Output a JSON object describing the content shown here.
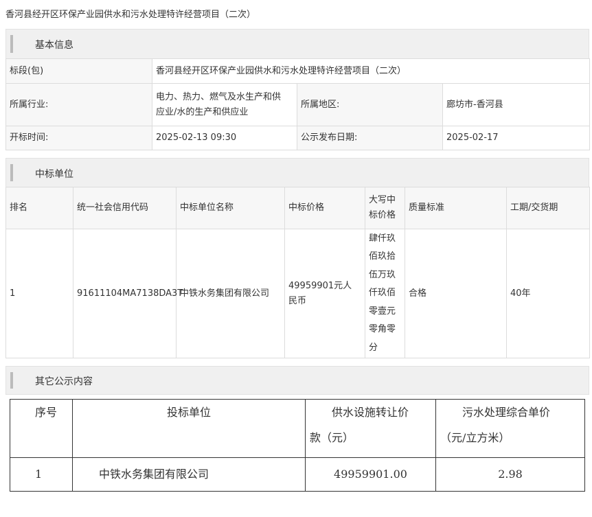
{
  "page": {
    "title": "香河县经开区环保产业园供水和污水处理特许经营项目（二次）"
  },
  "basic": {
    "header": "基本信息",
    "section_label": "标段(包)",
    "section_value": "香河县经开区环保产业园供水和污水处理特许经营项目（二次）",
    "industry_label": "所属行业:",
    "industry_value_line1": "电力、热力、燃气及水生产和供",
    "industry_value_line2": "应业/水的生产和供应业",
    "region_label": "所属地区:",
    "region_value": "廊坊市-香河县",
    "open_time_label": "开标时间:",
    "open_time_value": "2025-02-13 09:30",
    "publish_date_label": "公示发布日期:",
    "publish_date_value": "2025-02-17"
  },
  "winner": {
    "header": "中标单位",
    "columns": {
      "rank": "排名",
      "credit_code": "统一社会信用代码",
      "name": "中标单位名称",
      "price": "中标价格",
      "price_upper_l1": "大写中",
      "price_upper_l2": "标价格",
      "quality": "质量标准",
      "period": "工期/交货期"
    },
    "row": {
      "rank": "1",
      "credit_code": "91611104MA7138DA3T",
      "name": "中铁水务集团有限公司",
      "price_l1": "49959901元人",
      "price_l2": "民币",
      "price_upper_lines": [
        "肆仟玖",
        "佰玖拾",
        "伍万玖",
        "仟玖佰",
        "零壹元",
        "零角零",
        "分"
      ],
      "quality": "合格",
      "period": "40年"
    }
  },
  "other": {
    "header": "其它公示内容",
    "columns": {
      "seq": "序号",
      "bidder": "投标单位",
      "supply_l1": "供水设施转让价",
      "supply_l2": "款（元）",
      "sewage_l1": "污水处理综合单价",
      "sewage_l2": "（元/立方米）"
    },
    "row": {
      "seq": "1",
      "bidder": "中铁水务集团有限公司",
      "supply": "49959901.00",
      "sewage": "2.98"
    }
  }
}
